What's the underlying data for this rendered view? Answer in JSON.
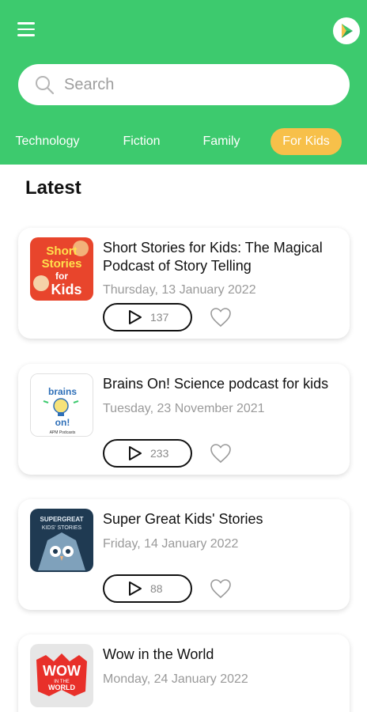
{
  "header": {
    "menu_icon": "hamburger-menu-icon",
    "logo_icon": "app-logo-play-icon",
    "accent_color": "#3dca6e"
  },
  "search": {
    "placeholder": "Search",
    "icon": "search-icon"
  },
  "tabs": [
    {
      "label": "Technology",
      "active": false
    },
    {
      "label": "Fiction",
      "active": false
    },
    {
      "label": "Family",
      "active": false
    },
    {
      "label": "For Kids",
      "active": true
    }
  ],
  "active_tab_color": "#f7c04a",
  "section": {
    "title": "Latest"
  },
  "podcasts": [
    {
      "title": "Short Stories for Kids: The Magical Podcast of Story Telling",
      "date": "Thursday, 13 January 2022",
      "plays": "137",
      "art_text": [
        "Short",
        "Stories",
        "for",
        "Kids"
      ]
    },
    {
      "title": "Brains On! Science podcast for kids",
      "date": "Tuesday, 23 November 2021",
      "plays": "233",
      "art_text": [
        "brains",
        "on!",
        "APM Podcasts"
      ]
    },
    {
      "title": "Super Great Kids' Stories",
      "date": "Friday, 14 January 2022",
      "plays": "88",
      "art_text": [
        "SUPERGREAT",
        "KIDS' STORIES"
      ]
    },
    {
      "title": "Wow in the World",
      "date": "Monday, 24 January 2022",
      "plays": "",
      "art_text": [
        "WOW",
        "IN THE",
        "WORLD"
      ]
    }
  ]
}
